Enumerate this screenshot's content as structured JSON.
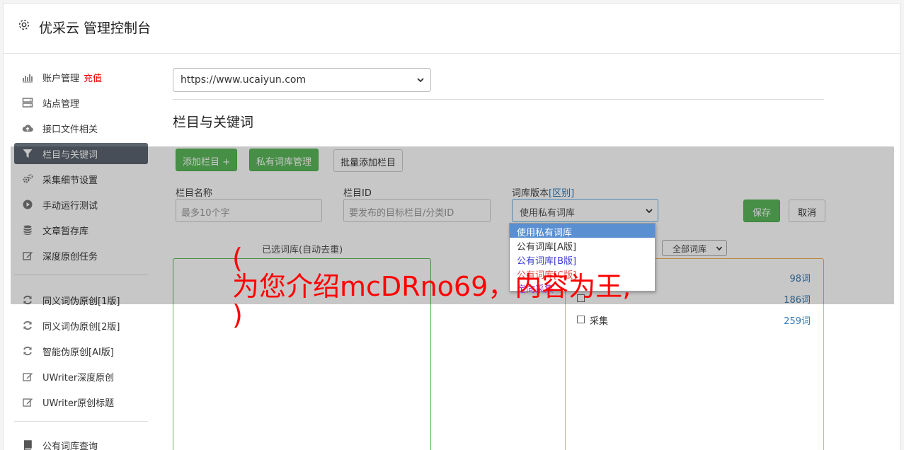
{
  "header": {
    "title": "优采云 管理控制台",
    "icon": "gear-icon"
  },
  "sidebar": {
    "group1": [
      {
        "label": "账户管理",
        "badge": "充值",
        "icon": "bar-chart-icon"
      },
      {
        "label": "站点管理",
        "icon": "server-icon"
      },
      {
        "label": "接口文件相关",
        "icon": "cloud-upload-icon"
      },
      {
        "label": "栏目与关键词",
        "icon": "filter-icon",
        "active": true
      },
      {
        "label": "采集细节设置",
        "icon": "cogs-icon"
      },
      {
        "label": "手动运行测试",
        "icon": "play-circle-icon"
      },
      {
        "label": "文章暂存库",
        "icon": "database-icon"
      },
      {
        "label": "深度原创任务",
        "icon": "edit-icon"
      }
    ],
    "group2": [
      {
        "label": "同义词伪原创[1版]",
        "icon": "refresh-icon"
      },
      {
        "label": "同义词伪原创[2版]",
        "icon": "refresh-icon"
      },
      {
        "label": "智能伪原创[AI版]",
        "icon": "refresh-icon"
      },
      {
        "label": "UWriter深度原创",
        "icon": "edit-icon"
      },
      {
        "label": "UWriter原创标题",
        "icon": "edit-icon"
      }
    ],
    "group3": [
      {
        "label": "公有词库查询",
        "icon": "book-icon"
      }
    ]
  },
  "main": {
    "site_select": "https://www.ucaiyun.com",
    "section_title": "栏目与关键词",
    "buttons": {
      "add_column": "添加栏目 +",
      "private_lib": "私有词库管理",
      "batch_add": "批量添加栏目",
      "save": "保存",
      "cancel": "取消"
    },
    "form": {
      "name_label": "栏目名称",
      "name_placeholder": "最多10个字",
      "id_label": "栏目ID",
      "id_placeholder": "要发布的目标栏目/分类ID",
      "version_label": "词库版本",
      "version_diff": "[区别]",
      "version_value": "使用私有词库"
    },
    "dropdown_options": [
      {
        "label": "使用私有词库",
        "color": "#ffffff"
      },
      {
        "label": "公有词库[A版]",
        "color": "#333333"
      },
      {
        "label": "公有词库[B版]",
        "color": "#3b3bd6"
      },
      {
        "label": "公有词库[C版]",
        "color": "#d9534f"
      },
      {
        "label": "定向采集",
        "color": "#9b30c8"
      }
    ],
    "selected_lib_label": "已选词库(自动去重)",
    "lib_filter": "全部词库",
    "libs": [
      {
        "name": "",
        "count": "98词"
      },
      {
        "name": "",
        "count": "186词"
      },
      {
        "name": "采集",
        "count": "259词"
      }
    ]
  },
  "watermark": {
    "lines": [
      "(",
      "为您介绍mcDRno69，内容为王,",
      ")"
    ],
    "color": "#ff0000"
  }
}
